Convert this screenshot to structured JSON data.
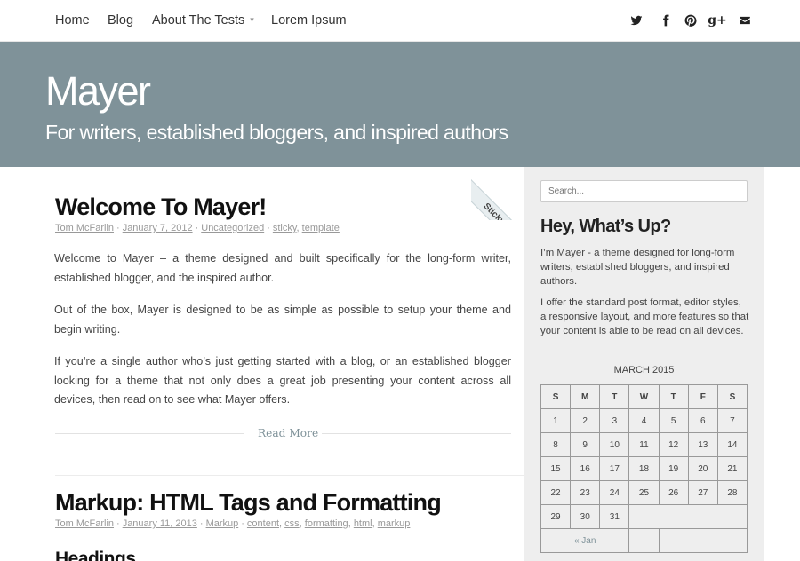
{
  "nav": {
    "items": [
      "Home",
      "Blog",
      "About The Tests",
      "Lorem Ipsum"
    ],
    "caret": "▾"
  },
  "social": {
    "icons": [
      "twitter-icon",
      "facebook-icon",
      "pinterest-icon",
      "google-plus-icon",
      "envelope-icon"
    ],
    "gplus_glyph": "g+"
  },
  "site": {
    "title": "Mayer",
    "description": "For writers, established bloggers, and inspired authors"
  },
  "sticky_label": "Sticky",
  "post1": {
    "title": "Welcome To Mayer!",
    "author": "Tom McFarlin",
    "date": "January 7, 2012",
    "category": "Uncategorized",
    "tags": [
      "sticky",
      "template"
    ],
    "paragraphs": [
      "Welcome to Mayer – a theme designed and built specifically for the long-form writer, established blogger, and the inspired author.",
      "Out of the box, Mayer is designed to be as simple as possible to setup your theme and begin writing.",
      "If you’re a single author who’s just getting started with a blog, or an established blogger looking for a theme that not only does a great job presenting your content across all devices, then read on to see what Mayer offers."
    ],
    "read_more": "Read More"
  },
  "post2": {
    "title": "Markup: HTML Tags and Formatting",
    "author": "Tom McFarlin",
    "date": "January 11, 2013",
    "category": "Markup",
    "tags": [
      "content",
      "css",
      "formatting",
      "html",
      "markup"
    ],
    "first_heading": "Headings"
  },
  "sidebar": {
    "search_placeholder": "Search...",
    "widget_title": "Hey, What’s Up?",
    "widget_paragraphs": [
      "I’m Mayer - a theme designed for long-form writers, established bloggers, and inspired authors.",
      "I offer the standard post format, editor styles, a responsive layout, and more features so that your content is able to be read on all devices."
    ],
    "calendar": {
      "caption": "MARCH 2015",
      "weekdays": [
        "S",
        "M",
        "T",
        "W",
        "T",
        "F",
        "S"
      ],
      "weeks": [
        [
          "1",
          "2",
          "3",
          "4",
          "5",
          "6",
          "7"
        ],
        [
          "8",
          "9",
          "10",
          "11",
          "12",
          "13",
          "14"
        ],
        [
          "15",
          "16",
          "17",
          "18",
          "19",
          "20",
          "21"
        ],
        [
          "22",
          "23",
          "24",
          "25",
          "26",
          "27",
          "28"
        ],
        [
          "29",
          "30",
          "31"
        ]
      ],
      "prev_link": "« Jan"
    }
  }
}
